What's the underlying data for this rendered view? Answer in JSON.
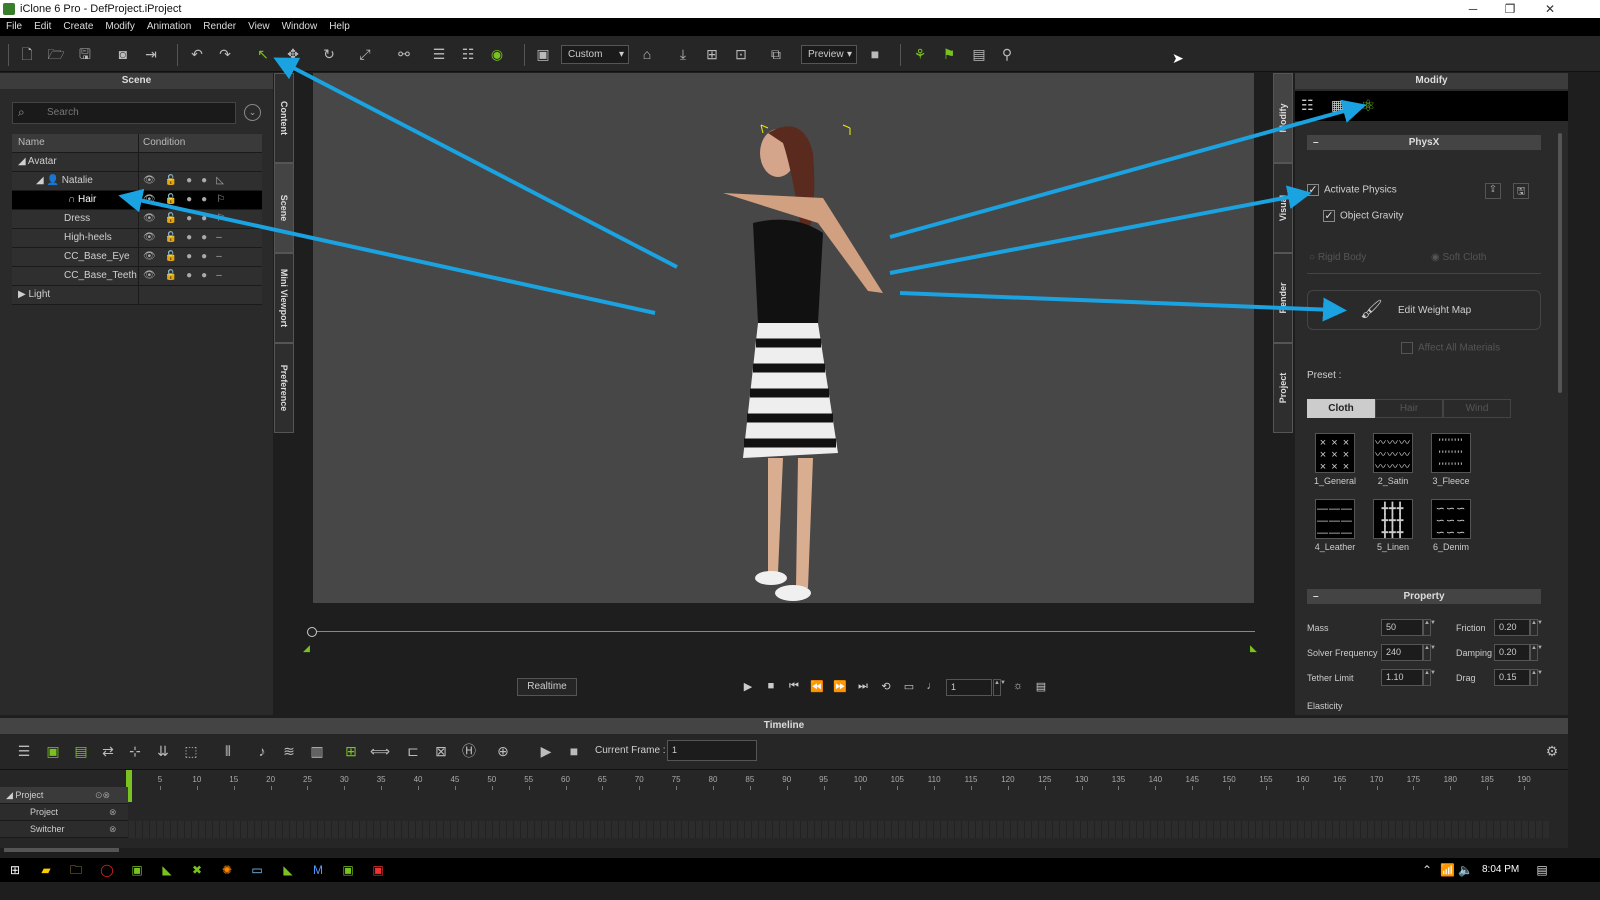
{
  "window": {
    "title": "iClone 6 Pro - DefProject.iProject"
  },
  "menu": [
    "File",
    "Edit",
    "Create",
    "Modify",
    "Animation",
    "Render",
    "View",
    "Window",
    "Help"
  ],
  "toolbar": {
    "camera_preset": "Custom",
    "preview": "Preview"
  },
  "scene": {
    "title": "Scene",
    "search_placeholder": "Search",
    "col_name": "Name",
    "col_condition": "Condition",
    "rows": [
      {
        "label": "Avatar"
      },
      {
        "label": "Natalie"
      },
      {
        "label": "Hair"
      },
      {
        "label": "Dress"
      },
      {
        "label": "High-heels"
      },
      {
        "label": "CC_Base_Eye"
      },
      {
        "label": "CC_Base_Teeth"
      },
      {
        "label": "Light"
      }
    ]
  },
  "left_tabs": [
    "Content",
    "Scene",
    "Mini Viewport",
    "Preference"
  ],
  "right_tabs": [
    "Modify",
    "Visual",
    "Render",
    "Project"
  ],
  "playback": {
    "realtime": "Realtime",
    "frame": "1"
  },
  "modify": {
    "title": "Modify",
    "physx": "PhysX",
    "activate_physics": "Activate Physics",
    "object_gravity": "Object Gravity",
    "rigid_body": "Rigid Body",
    "soft_cloth": "Soft Cloth",
    "edit_weight_map": "Edit Weight Map",
    "affect_all": "Affect All Materials",
    "preset_label": "Preset :",
    "preset_tabs": [
      "Cloth",
      "Hair",
      "Wind"
    ],
    "presets": [
      {
        "label": "1_General",
        "glyph": "× × ×\n× × ×\n× × ×"
      },
      {
        "label": "2_Satin",
        "glyph": "〰〰〰\n〰〰〰\n〰〰〰"
      },
      {
        "label": "3_Fleece",
        "glyph": "''''''''\n''''''''\n''''''''"
      },
      {
        "label": "4_Leather",
        "glyph": "———\n———\n———"
      },
      {
        "label": "5_Linen",
        "glyph": "╋╋╋\n╋╋╋\n╋╋╋"
      },
      {
        "label": "6_Denim",
        "glyph": "∽∽∽\n∽∽∽\n∽∽∽"
      }
    ],
    "property": "Property",
    "props": {
      "mass_label": "Mass",
      "mass": "50",
      "solver_label": "Solver Frequency",
      "solver": "240",
      "tether_label": "Tether Limit",
      "tether": "1.10",
      "friction_label": "Friction",
      "friction": "0.20",
      "damping_label": "Damping",
      "damping": "0.20",
      "drag_label": "Drag",
      "drag": "0.15",
      "elasticity_label": "Elasticity"
    }
  },
  "timeline": {
    "title": "Timeline",
    "current_frame_label": "Current Frame :",
    "current_frame": "1",
    "ticks": [
      5,
      10,
      15,
      20,
      25,
      30,
      35,
      40,
      45,
      50,
      55,
      60,
      65,
      70,
      75,
      80,
      85,
      90,
      95,
      100,
      105,
      110,
      115,
      120,
      125,
      130,
      135,
      140,
      145,
      150,
      155,
      160,
      165,
      170,
      175,
      180,
      185,
      190
    ],
    "tracks": [
      "Project",
      "Project",
      "Switcher"
    ]
  },
  "taskbar": {
    "time": "8:04 PM"
  },
  "colors": {
    "accent": "#7ac21f",
    "annotation_arrow": "#1aa3e0"
  }
}
